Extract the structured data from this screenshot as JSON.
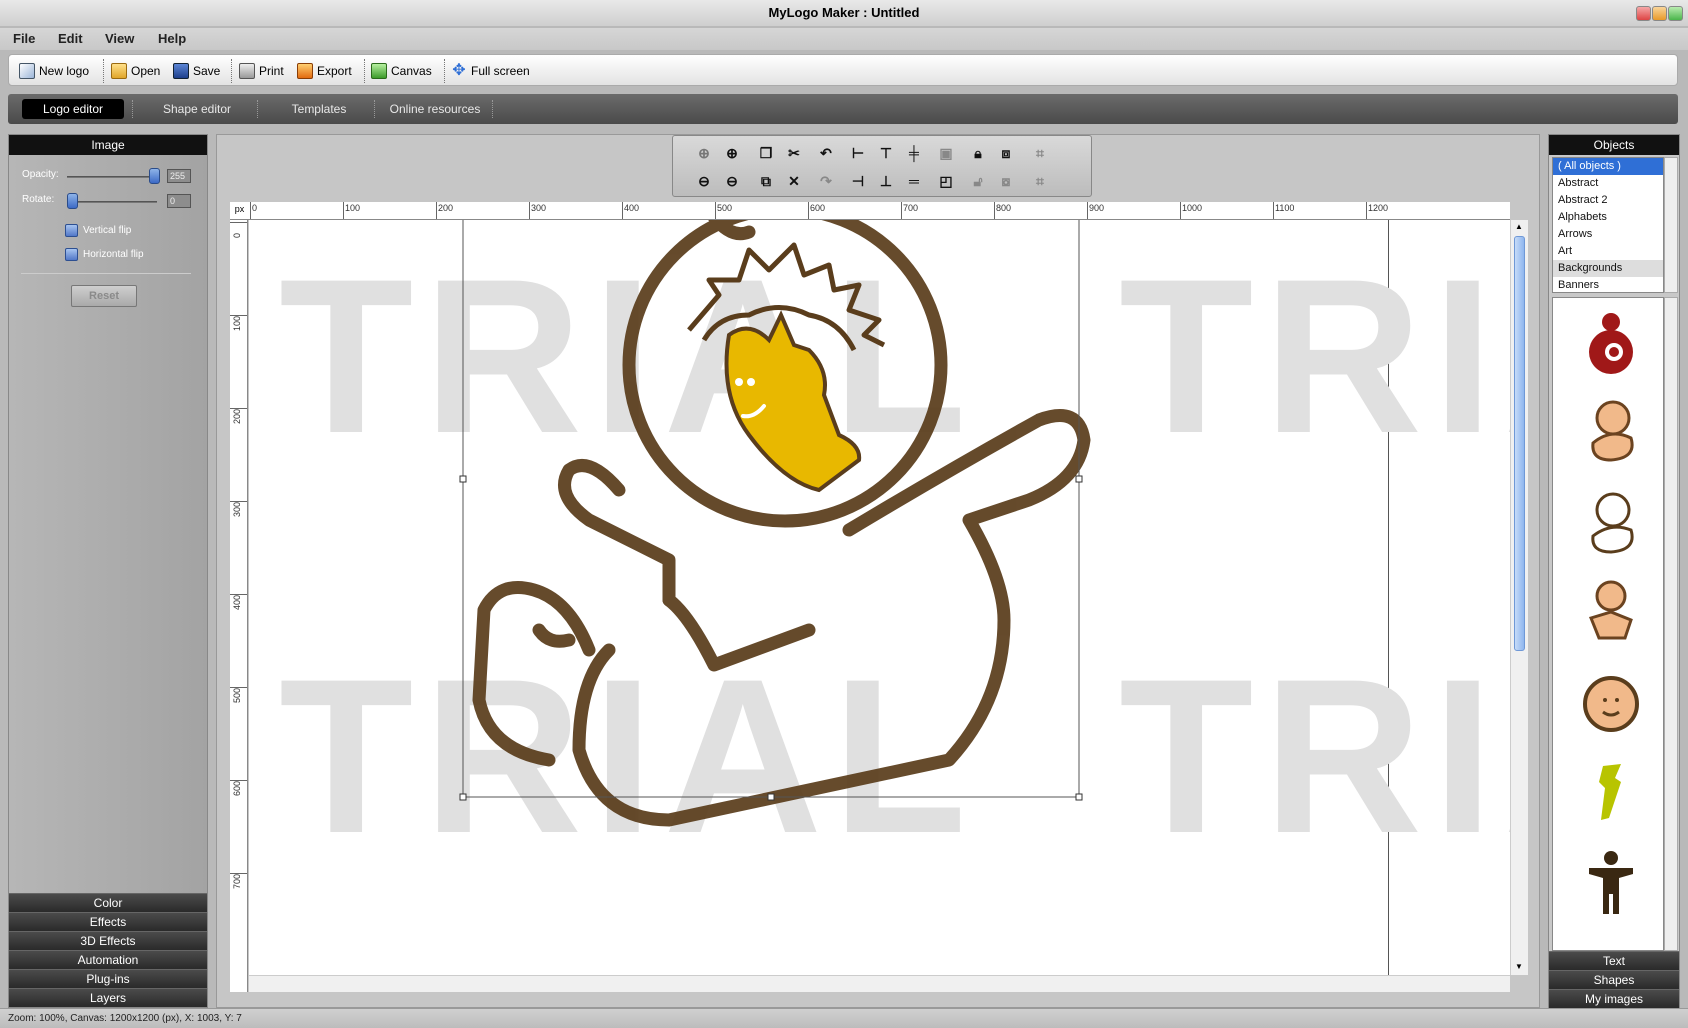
{
  "window": {
    "title": "MyLogo Maker : Untitled"
  },
  "menu": {
    "items": [
      "File",
      "Edit",
      "View",
      "Help"
    ]
  },
  "toolbar": {
    "new_logo": "New logo",
    "open": "Open",
    "save": "Save",
    "print": "Print",
    "export": "Export",
    "canvas": "Canvas",
    "full_screen": "Full screen"
  },
  "tabs": {
    "logo_editor": "Logo editor",
    "shape_editor": "Shape editor",
    "templates": "Templates",
    "online_resources": "Online resources"
  },
  "left_panel": {
    "header": "Image",
    "opacity_label": "Opacity:",
    "opacity_value": "255",
    "rotate_label": "Rotate:",
    "rotate_value": "0",
    "vertical_flip": "Vertical flip",
    "horizontal_flip": "Horizontal flip",
    "reset": "Reset",
    "sections": [
      "Color",
      "Effects",
      "3D Effects",
      "Automation",
      "Plug-ins",
      "Layers"
    ]
  },
  "ruler": {
    "unit": "px",
    "top_ticks": [
      "0",
      "100",
      "200",
      "300",
      "400",
      "500",
      "600",
      "700",
      "800",
      "900",
      "1000",
      "1100",
      "1200"
    ],
    "left_ticks": [
      "0",
      "100",
      "200",
      "300",
      "400",
      "500",
      "600",
      "700"
    ]
  },
  "canvas": {
    "watermark": "TRIAL"
  },
  "right_panel": {
    "header": "Objects",
    "categories": [
      "( All objects )",
      "Abstract",
      "Abstract 2",
      "Alphabets",
      "Arrows",
      "Art",
      "Backgrounds",
      "Banners"
    ],
    "selected_category": "( All objects )",
    "bottom_sections": [
      "Text",
      "Shapes",
      "My images"
    ]
  },
  "status": {
    "text": "Zoom: 100%, Canvas: 1200x1200 (px), X: 1003, Y: 7"
  },
  "colors": {
    "logo_outline": "#5a3d1c",
    "logo_face": "#e8b800",
    "panel_header": "#111111",
    "selection_blue": "#2f6fd6"
  }
}
